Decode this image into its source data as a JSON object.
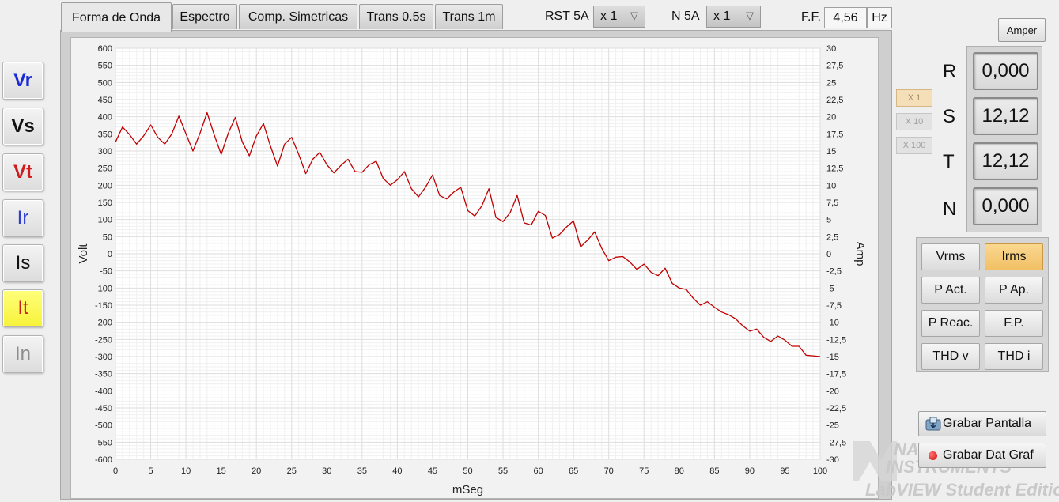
{
  "channels": [
    {
      "label": "Vr",
      "color": "#1a2bd6",
      "bold": true,
      "active": false
    },
    {
      "label": "Vs",
      "color": "#111111",
      "bold": true,
      "active": false
    },
    {
      "label": "Vt",
      "color": "#d01c1c",
      "bold": true,
      "active": false
    },
    {
      "label": "Ir",
      "color": "#2e3fd0",
      "bold": false,
      "active": false
    },
    {
      "label": "Is",
      "color": "#111111",
      "bold": false,
      "active": false
    },
    {
      "label": "It",
      "color": "#d01c1c",
      "bold": false,
      "active": true
    },
    {
      "label": "In",
      "color": "#8c8c8c",
      "bold": false,
      "active": false
    }
  ],
  "tabs": [
    "Forma de Onda",
    "Espectro",
    "Comp. Simetricas",
    "Trans 0.5s",
    "Trans 1m"
  ],
  "active_tab": 0,
  "toolbar": {
    "rst_label": "RST 5A",
    "rst_value": "x 1",
    "n_label": "N 5A",
    "n_value": "x 1",
    "ff_label": "F.F.",
    "ff_value": "4,56",
    "ff_unit": "Hz"
  },
  "scale_buttons": [
    {
      "label": "X 1",
      "active": true
    },
    {
      "label": "X 10",
      "active": false
    },
    {
      "label": "X 100",
      "active": false
    }
  ],
  "amper_label": "Amper",
  "phases": [
    {
      "label": "R",
      "value": "0,000"
    },
    {
      "label": "S",
      "value": "12,12"
    },
    {
      "label": "T",
      "value": "12,12"
    },
    {
      "label": "N",
      "value": "0,000"
    }
  ],
  "measures": [
    {
      "label": "Vrms",
      "active": false
    },
    {
      "label": "Irms",
      "active": true
    },
    {
      "label": "P Act.",
      "active": false
    },
    {
      "label": "P Ap.",
      "active": false
    },
    {
      "label": "P Reac.",
      "active": false
    },
    {
      "label": "F.P.",
      "active": false
    },
    {
      "label": "THD v",
      "active": false
    },
    {
      "label": "THD i",
      "active": false
    }
  ],
  "actions": {
    "save_screen": "Grabar Pantalla",
    "save_data": "Grabar Dat Graf"
  },
  "watermark": {
    "line1": "NATIONAL",
    "line2": "INSTRUMENTS",
    "line3": "LabVIEW Student Edition"
  },
  "chart_data": {
    "type": "line",
    "xlabel": "mSeg",
    "ylabel": "Volt",
    "y2label": "Amp",
    "xlim": [
      0,
      100
    ],
    "ylim": [
      -600,
      600
    ],
    "y2lim": [
      -30,
      30
    ],
    "xticks": [
      0,
      5,
      10,
      15,
      20,
      25,
      30,
      35,
      40,
      45,
      50,
      55,
      60,
      65,
      70,
      75,
      80,
      85,
      90,
      95,
      100
    ],
    "yticks": [
      600,
      550,
      500,
      450,
      400,
      350,
      300,
      250,
      200,
      150,
      100,
      50,
      0,
      -50,
      -100,
      -150,
      -200,
      -250,
      -300,
      -350,
      -400,
      -450,
      -500,
      -550,
      -600
    ],
    "y2ticks": [
      "30",
      "27,5",
      "25",
      "22,5",
      "20",
      "17,5",
      "15",
      "12,5",
      "10",
      "7,5",
      "5",
      "2,5",
      "0",
      "-2,5",
      "-5",
      "-7,5",
      "-10",
      "-12,5",
      "-15",
      "-17,5",
      "-20",
      "-22,5",
      "-25",
      "-27,5",
      "-30"
    ],
    "grid": true,
    "series": [
      {
        "color": "#c00000",
        "axis": "right",
        "x": [
          0,
          1,
          2,
          3,
          4,
          5,
          6,
          7,
          8,
          9,
          10,
          11,
          12,
          13,
          14,
          15,
          16,
          17,
          18,
          19,
          20,
          21,
          22,
          23,
          24,
          25,
          26,
          27,
          28,
          29,
          30,
          31,
          32,
          33,
          34,
          35,
          36,
          37,
          38,
          39,
          40,
          41,
          42,
          43,
          44,
          45,
          46,
          47,
          48,
          49,
          50,
          51,
          52,
          53,
          54,
          55,
          56,
          57,
          58,
          59,
          60,
          61,
          62,
          63,
          64,
          65,
          66,
          67,
          68,
          69,
          70,
          71,
          72,
          73,
          74,
          75,
          76,
          77,
          78,
          79,
          80,
          81,
          82,
          83,
          84,
          85,
          86,
          87,
          88,
          89,
          90,
          91,
          92,
          93,
          94,
          95,
          96,
          97,
          98,
          99,
          100
        ],
        "y": [
          16.3,
          18.5,
          17.4,
          16.0,
          17.2,
          18.8,
          17.0,
          16.0,
          17.5,
          20.1,
          17.5,
          15.0,
          17.6,
          20.6,
          17.4,
          14.5,
          17.6,
          19.9,
          16.3,
          14.3,
          17.2,
          19.0,
          15.7,
          12.8,
          16.0,
          17.0,
          14.5,
          11.7,
          13.8,
          14.8,
          13.0,
          11.8,
          12.9,
          13.8,
          12.0,
          11.9,
          13.0,
          13.5,
          11.0,
          10.0,
          10.8,
          12.0,
          9.5,
          8.3,
          9.7,
          11.5,
          8.5,
          8.0,
          9.0,
          9.7,
          6.3,
          5.5,
          7.0,
          9.5,
          5.3,
          4.7,
          6.0,
          8.5,
          4.5,
          4.2,
          6.2,
          5.6,
          2.3,
          2.8,
          3.9,
          4.8,
          1.0,
          2.0,
          3.2,
          0.8,
          -1.0,
          -0.5,
          -0.4,
          -1.2,
          -2.3,
          -1.5,
          -2.7,
          -3.2,
          -2.1,
          -4.3,
          -5.0,
          -5.2,
          -6.5,
          -7.5,
          -7.0,
          -7.8,
          -8.5,
          -8.9,
          -9.5,
          -10.5,
          -11.3,
          -11.0,
          -12.2,
          -12.8,
          -12.0,
          -12.6,
          -13.5,
          -13.5,
          -14.8,
          -14.9,
          -15.0
        ]
      }
    ]
  }
}
